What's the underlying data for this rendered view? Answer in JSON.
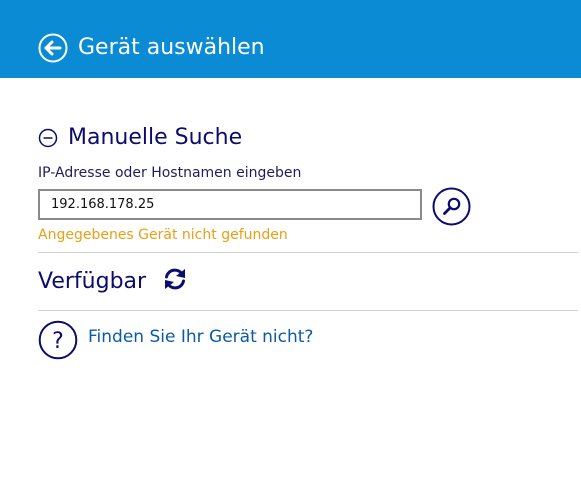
{
  "header": {
    "title": "Gerät auswählen",
    "back_icon": "back-arrow-circle-icon",
    "background": "#0a8bd4"
  },
  "manual_search": {
    "title": "Manuelle Suche",
    "toggle_icon": "collapse-minus-icon",
    "field_label": "IP-Adresse oder Hostnamen eingeben",
    "input_value": "192.168.178.25",
    "search_icon": "search-icon",
    "error_message": "Angegebenes Gerät nicht gefunden",
    "error_color": "#e8a012"
  },
  "available": {
    "title": "Verfügbar",
    "refresh_icon": "refresh-icon"
  },
  "help": {
    "icon": "question-circle-icon",
    "link_text": "Finden Sie Ihr Gerät nicht?"
  },
  "colors": {
    "heading": "#0c0c6e",
    "link": "#0a5aa8"
  }
}
